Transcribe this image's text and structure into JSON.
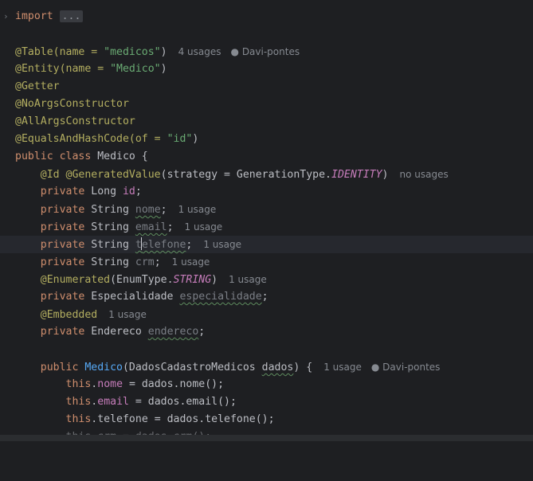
{
  "editor": {
    "fold_marker": "...",
    "hints": {
      "u4": "4 usages",
      "u1": "1 usage",
      "nousage": "no usages",
      "author": "Davi-pontes"
    },
    "lines": {
      "import_kw": "import",
      "table": "@Table(name = ",
      "table_val": "\"medicos\"",
      "table_close": ")",
      "entity": "@Entity(name = ",
      "entity_val": "\"Medico\"",
      "entity_close": ")",
      "getter": "@Getter",
      "noargs": "@NoArgsConstructor",
      "allargs": "@AllArgsConstructor",
      "eqhash": "@EqualsAndHashCode(of = ",
      "eqhash_val": "\"id\"",
      "eqhash_close": ")",
      "class_kw": "public class ",
      "class_name": "Medico {",
      "id_ann": "@Id @GeneratedValue",
      "id_args": "(strategy = GenerationType.",
      "identity": "IDENTITY",
      "id_close": ")",
      "private": "private",
      "long": " Long ",
      "id": "id",
      "semi": ";",
      "string": " String ",
      "nome": "nome",
      "email": "email",
      "telefone_a": "t",
      "telefone_b": "elefone",
      "crm": "crm",
      "enumerated": "@Enumerated",
      "enum_args": "(EnumType.",
      "string_const": "STRING",
      "enum_close": ")",
      "especialidade_type": " Especialidade ",
      "especialidade": "especialidade",
      "embedded": "@Embedded",
      "endereco_type": " Endereco ",
      "endereco": "endereco",
      "ctor_kw": "public ",
      "ctor_name": "Medico",
      "ctor_args": "(DadosCadastroMedicos ",
      "dados": "dados",
      "ctor_close": ") {",
      "this": "this",
      "b1_field": "nome",
      "b1_rest": " = dados.nome();",
      "b2_field": "email",
      "b2_rest": " = dados.email();",
      "b3_rest": ".telefone = dados.telefone();",
      "b4_partial": "this.crm = dados.crm();"
    }
  }
}
